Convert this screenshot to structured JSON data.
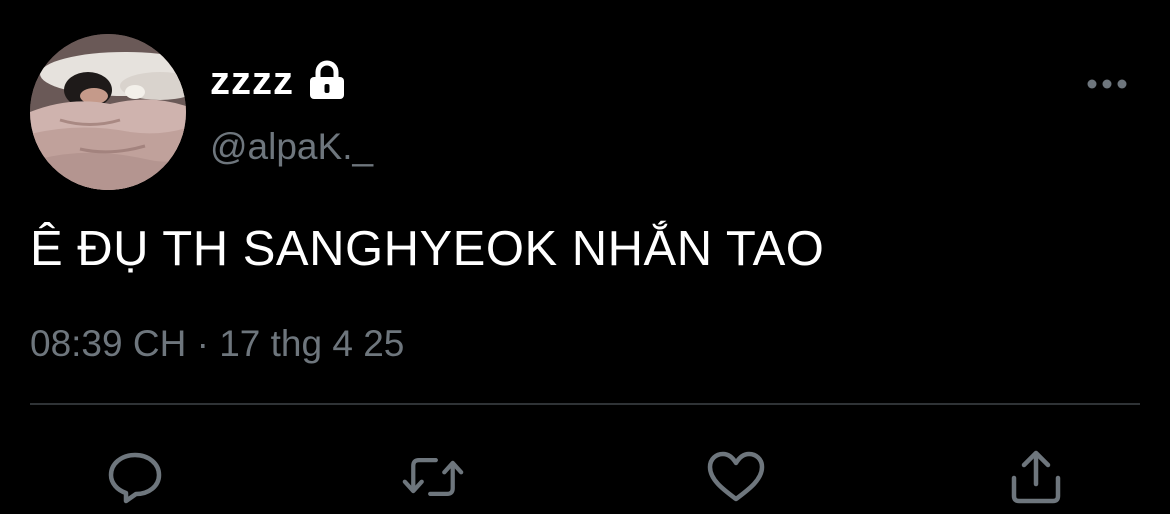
{
  "user": {
    "display_name": "zzzz",
    "handle": "@alpaK._",
    "avatar_icon": "avatar-photo",
    "verified_icon": "lock-icon"
  },
  "tweet": {
    "text": "Ê ĐỤ TH SANGHYEOK NHẮN TAO",
    "timestamp": "08:39 CH · 17 thg 4 25"
  },
  "actions": {
    "reply_icon": "reply-icon",
    "retweet_icon": "retweet-icon",
    "like_icon": "heart-icon",
    "share_icon": "share-icon",
    "more_icon": "more-icon"
  },
  "colors": {
    "background": "#000000",
    "text_primary": "#ffffff",
    "text_secondary": "#6e767d",
    "divider": "#2f3336"
  }
}
